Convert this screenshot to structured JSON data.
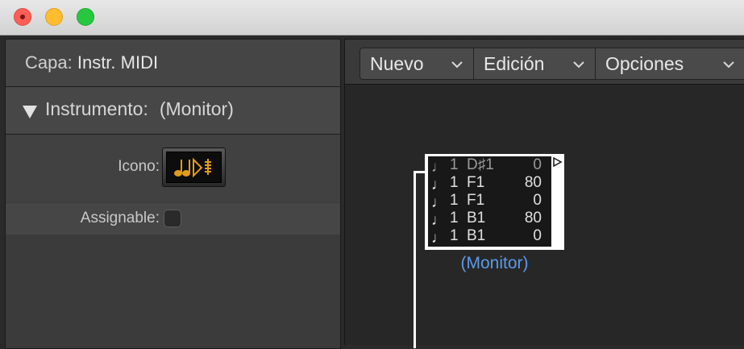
{
  "window": {
    "controls": [
      "close",
      "minimize",
      "zoom"
    ]
  },
  "inspector": {
    "layer_label": "Capa:",
    "layer_value": "Instr. MIDI",
    "section_title": "Instrumento:",
    "section_value": "(Monitor)",
    "icon_label": "Icono:",
    "icon_name": "midi-notes-icon",
    "assignable_label": "Assignable:",
    "assignable_checked": false
  },
  "toolbar": {
    "menus": [
      {
        "label": "Nuevo"
      },
      {
        "label": "Edición"
      },
      {
        "label": "Opciones"
      }
    ]
  },
  "monitor": {
    "label": "(Monitor)",
    "events": [
      {
        "channel": "1",
        "pitch": "D♯1",
        "velocity": "0"
      },
      {
        "channel": "1",
        "pitch": "F1",
        "velocity": "80"
      },
      {
        "channel": "1",
        "pitch": "F1",
        "velocity": "0"
      },
      {
        "channel": "1",
        "pitch": "B1",
        "velocity": "80"
      },
      {
        "channel": "1",
        "pitch": "B1",
        "velocity": "0"
      }
    ]
  },
  "colors": {
    "accent_label": "#5b9ae8",
    "icon_amber": "#e39b1c"
  }
}
